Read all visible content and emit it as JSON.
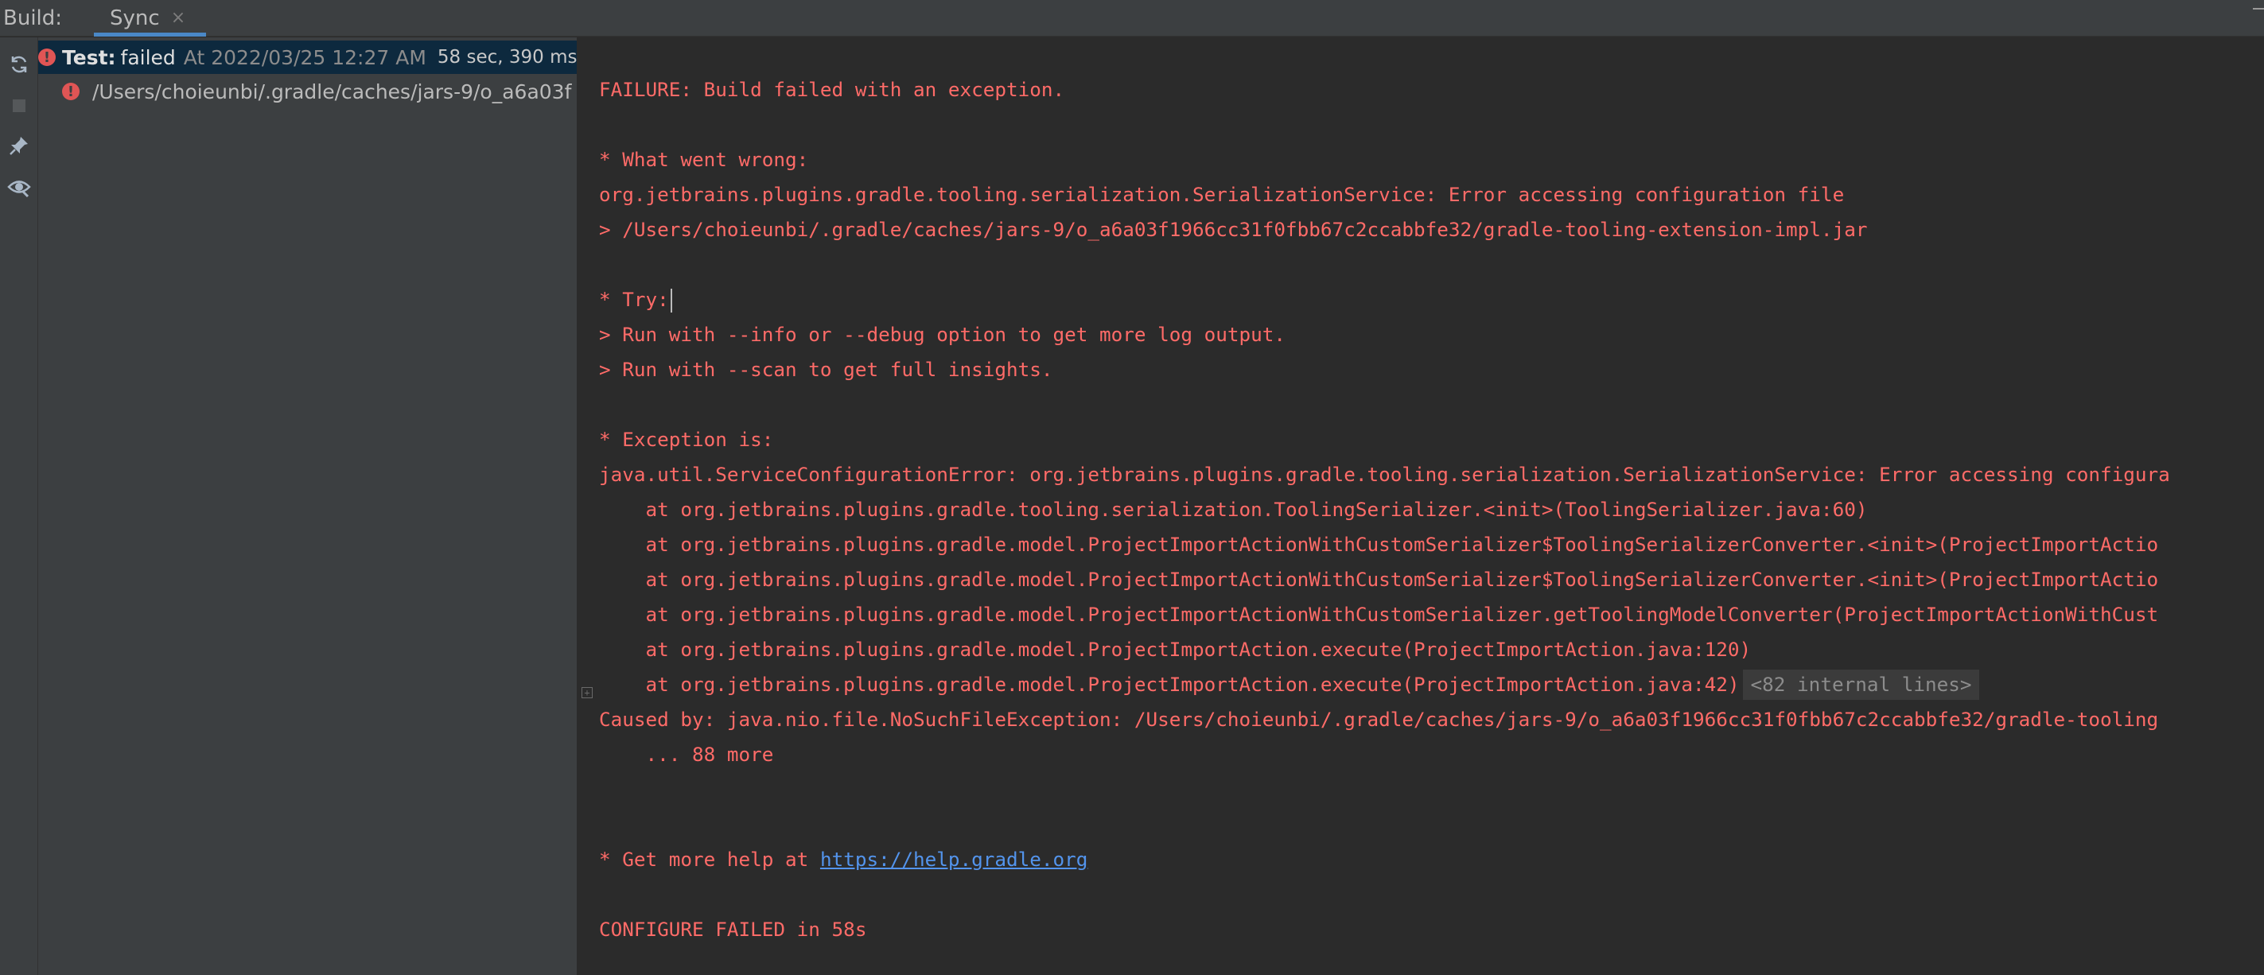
{
  "toolwindow": {
    "title": "Build:",
    "tab_label": "Sync",
    "tab_close": "×"
  },
  "toolbar": {
    "icons": [
      "sync-icon",
      "stop-icon",
      "pin-icon",
      "eye-icon"
    ]
  },
  "tree": {
    "root": {
      "status_icon": "!",
      "label": "Test:",
      "status": "failed",
      "timestamp": "At 2022/03/25 12:27 AM",
      "duration": "58 sec, 390 ms"
    },
    "child": {
      "status_icon": "!",
      "path": "/Users/choieunbi/.gradle/caches/jars-9/o_a6a03f"
    }
  },
  "console": {
    "lines": [
      "FAILURE: Build failed with an exception.",
      "",
      "* What went wrong:",
      "org.jetbrains.plugins.gradle.tooling.serialization.SerializationService: Error accessing configuration file",
      "> /Users/choieunbi/.gradle/caches/jars-9/o_a6a03f1966cc31f0fbb67c2ccabbfe32/gradle-tooling-extension-impl.jar",
      "",
      "* Try:",
      "> Run with --info or --debug option to get more log output.",
      "> Run with --scan to get full insights.",
      "",
      "* Exception is:",
      "java.util.ServiceConfigurationError: org.jetbrains.plugins.gradle.tooling.serialization.SerializationService: Error accessing configura",
      "    at org.jetbrains.plugins.gradle.tooling.serialization.ToolingSerializer.<init>(ToolingSerializer.java:60)",
      "    at org.jetbrains.plugins.gradle.model.ProjectImportActionWithCustomSerializer$ToolingSerializerConverter.<init>(ProjectImportActio",
      "    at org.jetbrains.plugins.gradle.model.ProjectImportActionWithCustomSerializer$ToolingSerializerConverter.<init>(ProjectImportActio",
      "    at org.jetbrains.plugins.gradle.model.ProjectImportActionWithCustomSerializer.getToolingModelConverter(ProjectImportActionWithCust",
      "    at org.jetbrains.plugins.gradle.model.ProjectImportAction.execute(ProjectImportAction.java:120)",
      "    at org.jetbrains.plugins.gradle.model.ProjectImportAction.execute(ProjectImportAction.java:42)",
      "Caused by: java.nio.file.NoSuchFileException: /Users/choieunbi/.gradle/caches/jars-9/o_a6a03f1966cc31f0fbb67c2ccabbfe32/gradle-tooling",
      "    ... 88 more",
      "",
      "",
      "* Get more help at ",
      "",
      "CONFIGURE FAILED in 58s"
    ],
    "folded_lines": "<82 internal lines>",
    "fold_marker": "+",
    "help_link": "https://help.gradle.org"
  },
  "colors": {
    "error_text": "#ff6b68",
    "link": "#5394ec",
    "selection": "#0d293e",
    "panel_bg": "#3c3f41",
    "console_bg": "#2b2b2b",
    "tab_underline": "#4a88c7"
  }
}
